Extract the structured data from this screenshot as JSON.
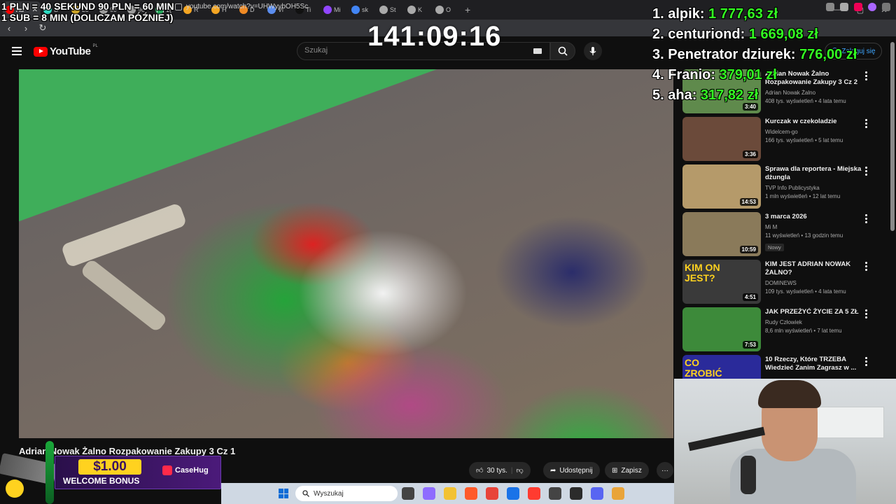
{
  "browser": {
    "tabs": [
      {
        "label": "Ad",
        "color": "#ff0000",
        "active": true
      },
      {
        "label": "D",
        "color": "#2bd9c0"
      },
      {
        "label": "Lc",
        "color": "#c9a227"
      },
      {
        "label": "9c",
        "color": "#9a9a9a"
      },
      {
        "label": "9c",
        "color": "#9a9a9a"
      },
      {
        "label": "1(",
        "color": "#23a559"
      },
      {
        "label": "R",
        "color": "#f5a623"
      },
      {
        "label": "H",
        "color": "#f5a623"
      },
      {
        "label": "D",
        "color": "#f08a24"
      },
      {
        "label": "Vi",
        "color": "#5b8def"
      },
      {
        "label": "Ti",
        "color": "#111111"
      },
      {
        "label": "Mi",
        "color": "#9146ff"
      },
      {
        "label": "sk",
        "color": "#4285f4"
      },
      {
        "label": "St",
        "color": "#aaaaaa"
      },
      {
        "label": "K",
        "color": "#aaaaaa"
      },
      {
        "label": "O",
        "color": "#aaaaaa"
      }
    ],
    "new_tab": "+",
    "url": "youtube.com/watch?v=UHWyybOH5Sc"
  },
  "overlay": {
    "rate_line1": "1 PLN =  40 SEKUND 90 PLN = 60 MIN",
    "rate_line2": "1 SUB = 8 MIN (DOLICZAM PÓŹNIEJ)",
    "timer": "141:09:16",
    "leaderboard": [
      {
        "name": "1. alpik: ",
        "amount": "1 777,63 zł"
      },
      {
        "name": "2. centuriond: ",
        "amount": "1 669,08 zł"
      },
      {
        "name": "3. Penetrator dziurek: ",
        "amount": "776,00 zł"
      },
      {
        "name": "4. Franio: ",
        "amount": "379,01 zł"
      },
      {
        "name": "5. aha: ",
        "amount": "317,82 zł"
      }
    ]
  },
  "youtube": {
    "logo": "YouTube",
    "region": "PL",
    "search_placeholder": "Szukaj",
    "signin": "Zaloguj się",
    "video_title": "Adrian Nowak Żalno Rozpakowanie Zakupy 3 Cz 1",
    "likes": "30 tys.",
    "share": "Udostępnij",
    "save": "Zapisz"
  },
  "recommendations": [
    {
      "title": "Adrian Nowak Żalno Rozpakowanie Zakupy 3 Cz 2",
      "channel": "Adrian Nowak Żalno",
      "meta": "408 tys. wyświetleń • 4 lata temu",
      "duration": "3:40",
      "thumb": "#5f8a4c"
    },
    {
      "title": "Kurczak w czekoladzie",
      "channel": "Widelcem-go",
      "meta": "166 tys. wyświetleń • 5 lat temu",
      "duration": "3:36",
      "thumb": "#6b4a3a"
    },
    {
      "title": "Sprawa dla reportera - Miejska dżungla",
      "channel": "TVP Info Publicystyka",
      "meta": "1 mln wyświetleń • 12 lat temu",
      "duration": "14:53",
      "thumb": "#b59a6a"
    },
    {
      "title": "3 marca 2026",
      "channel": "Mi M",
      "meta": "11 wyświetleń • 13 godzin temu",
      "duration": "10:59",
      "thumb": "#8a7a5a",
      "badge": "Nowy"
    },
    {
      "title": "KIM JEST ADRIAN NOWAK ŻALNO?",
      "channel": "DOMINEWS",
      "meta": "109 tys. wyświetleń • 4 lata temu",
      "duration": "4:51",
      "thumb": "#3a3a3a",
      "thumb_text": "KIM ON JEST?"
    },
    {
      "title": "JAK PRZEŻYĆ ŻYCIE ZA 5 ZŁ",
      "channel": "Rudy Człowiek",
      "meta": "8,6 mln wyświetleń • 7 lat temu",
      "duration": "7:53",
      "thumb": "#3d8a3a"
    },
    {
      "title": "10 Rzeczy, Które TRZEBA Wiedzieć Zanim Zagrasz w ...",
      "channel": "",
      "meta": "",
      "duration": "",
      "thumb": "#2a2a9a",
      "thumb_text": "CO ZROBIĆ"
    }
  ],
  "ad": {
    "price": "$1.00",
    "bonus": "WELCOME BONUS",
    "brand": "CaseHug"
  },
  "taskbar": {
    "search_placeholder": "Wyszukaj",
    "apps": [
      "#444444",
      "#8e6cff",
      "#f2c233",
      "#ff5a2a",
      "#e8443a",
      "#1a73e8",
      "#ff3b30",
      "#444444",
      "#2b2b2b",
      "#5865f2",
      "#e9a43a"
    ]
  }
}
